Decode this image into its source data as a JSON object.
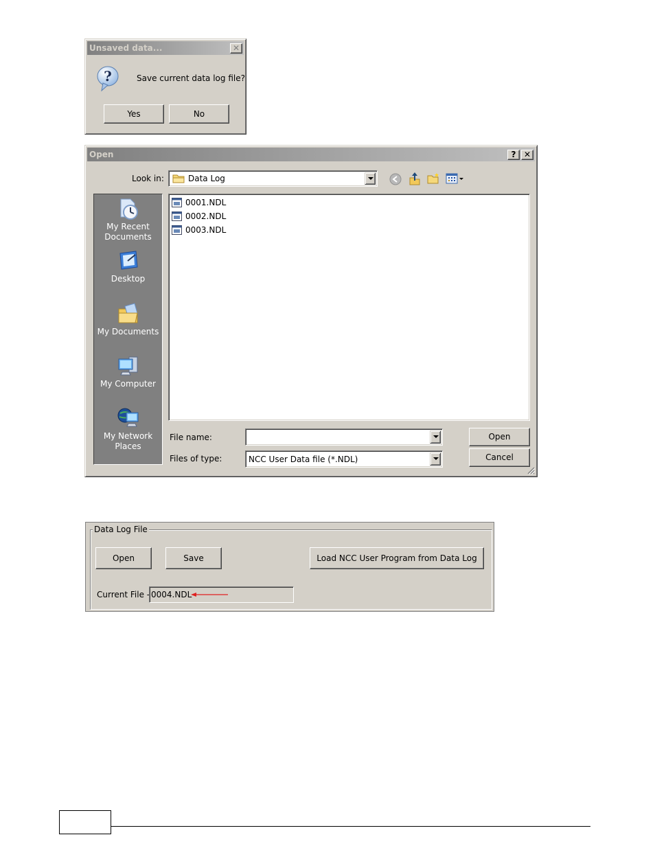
{
  "unsaved_dialog": {
    "title": "Unsaved data...",
    "close_label": "✕",
    "message": "Save current data log file?",
    "icon": "question-icon",
    "buttons": {
      "yes": "Yes",
      "no": "No"
    }
  },
  "open_dialog": {
    "title": "Open",
    "help_label": "?",
    "close_label": "✕",
    "look_in_label": "Look in:",
    "look_in_value": "Data Log",
    "toolbar_icons": [
      "back-icon",
      "up-folder-icon",
      "new-folder-icon",
      "view-menu-icon"
    ],
    "places": [
      {
        "label": "My Recent Documents",
        "icon": "recent-documents-icon"
      },
      {
        "label": "Desktop",
        "icon": "desktop-icon"
      },
      {
        "label": "My Documents",
        "icon": "my-documents-icon"
      },
      {
        "label": "My Computer",
        "icon": "my-computer-icon"
      },
      {
        "label": "My Network Places",
        "icon": "network-places-icon"
      }
    ],
    "files": [
      "0001.NDL",
      "0002.NDL",
      "0003.NDL"
    ],
    "file_name_label": "File name:",
    "file_name_value": "",
    "files_of_type_label": "Files of type:",
    "files_of_type_value": "NCC User Data file (*.NDL)",
    "open_button": "Open",
    "cancel_button": "Cancel"
  },
  "data_log_panel": {
    "title": "Data Log File",
    "open_button": "Open",
    "save_button": "Save",
    "load_button": "Load NCC User Program from Data Log",
    "current_file_label": "Current File -",
    "current_file_value": "0004.NDL",
    "arrow_color": "#e02020"
  },
  "colors": {
    "dialog_face": "#d4d0c8",
    "places_bg": "#808080",
    "title_gradient_start": "#808080",
    "title_gradient_end": "#c0c0c0"
  }
}
